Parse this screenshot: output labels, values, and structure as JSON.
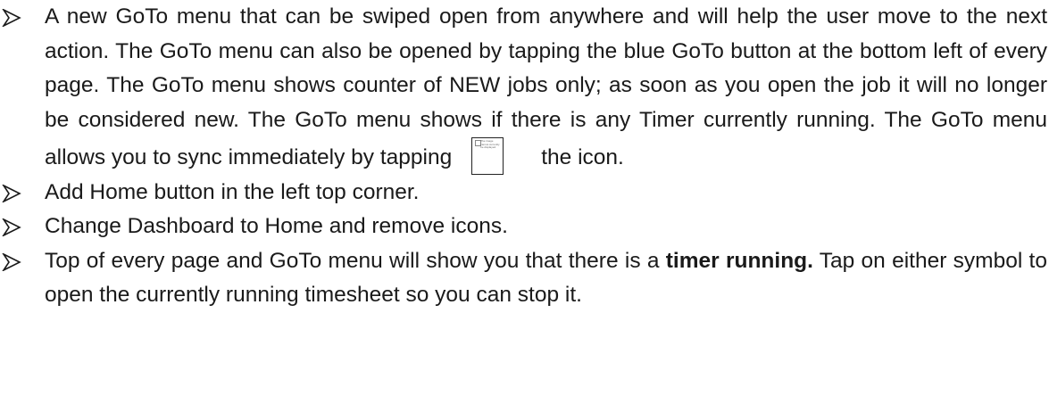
{
  "bullets": [
    {
      "text_before_icon": "A new GoTo menu that can be swiped open from anywhere and will help the user move to the next action. The GoTo menu can also be opened by tapping the blue GoTo button at the bottom left of every page. The GoTo menu shows counter of NEW jobs only; as soon as you open the job it will no longer be considered new. The GoTo menu shows if there is any Timer currently running. The GoTo menu allows you to sync immediately by tapping",
      "icon_placeholder_text": "The image cannot currently be displayed.",
      "text_after_icon": "the icon."
    },
    {
      "text": "Add Home button in the left top corner."
    },
    {
      "text": "Change Dashboard to Home and remove icons."
    },
    {
      "text_before_bold": "Top of every page and GoTo menu will show you that there is a ",
      "bold_text": "timer running.",
      "text_after_bold": " Tap on either symbol to open the currently running timesheet so you can stop it."
    }
  ],
  "icons": {
    "bullet": "arrowhead-bullet-icon",
    "inline": "broken-image-icon"
  }
}
